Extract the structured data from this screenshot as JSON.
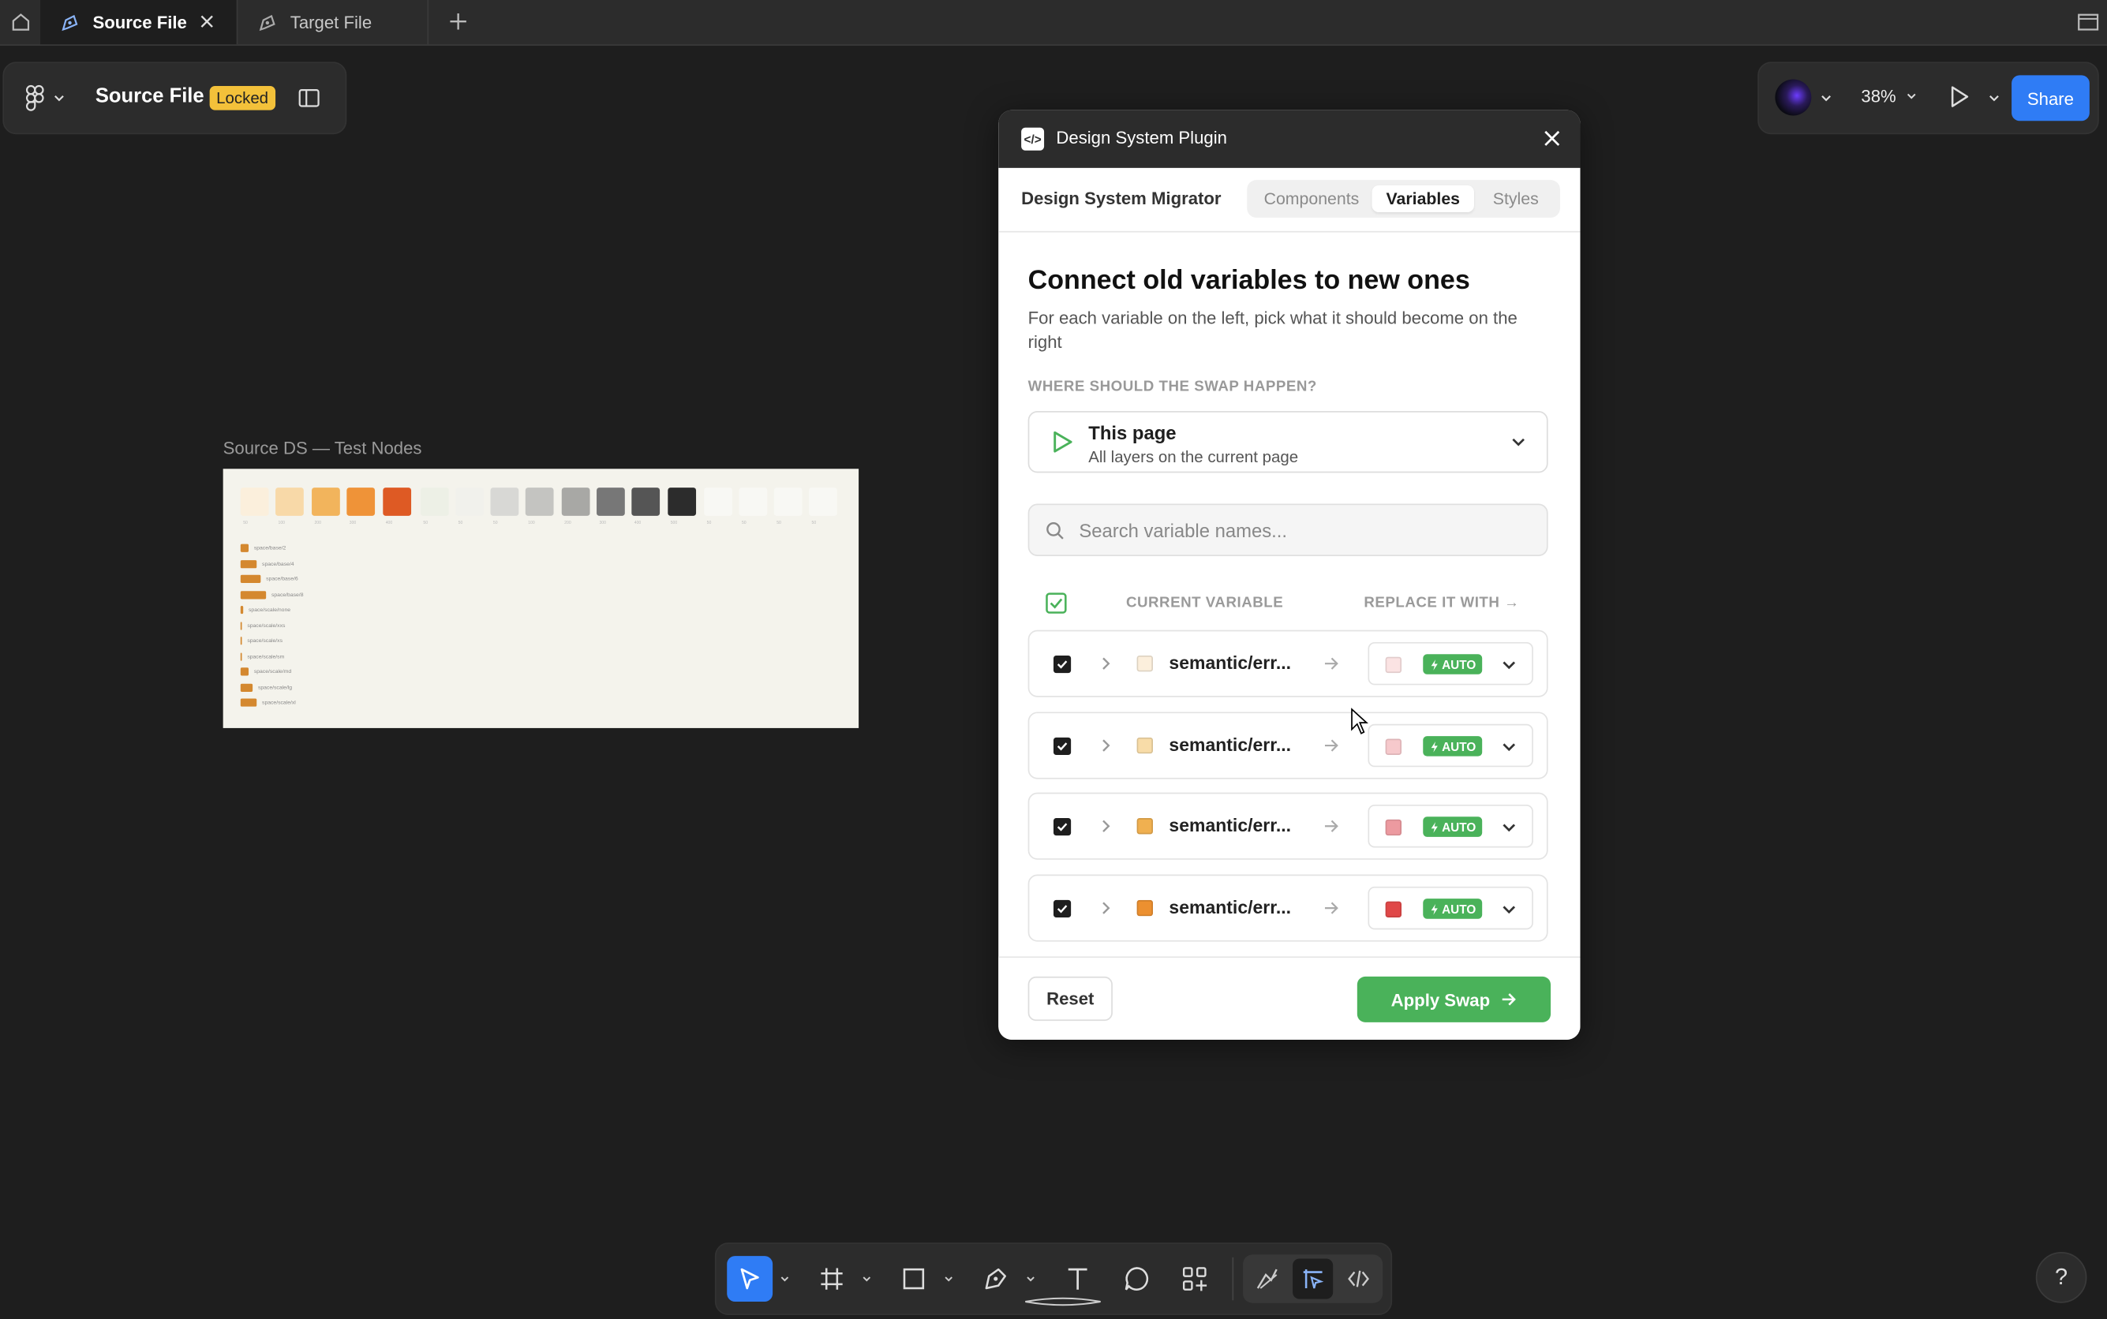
{
  "tabs": {
    "active": "Source File",
    "inactive": "Target File"
  },
  "toolbar": {
    "file_name": "Source File",
    "locked_badge": "Locked",
    "zoom": "38%",
    "share_label": "Share"
  },
  "canvas": {
    "frame_label": "Source DS — Test Nodes",
    "swatch_colors": [
      "#fbefdc",
      "#f8d9a8",
      "#f2b45c",
      "#ef9338",
      "#de5a24",
      "#edf0e6",
      "#f1f1ec",
      "#d8d8d5",
      "#c4c4c1",
      "#a8a8a5",
      "#777777",
      "#555555",
      "#2c2c2c",
      "#f8f8f4",
      "#f8f8f4",
      "#f8f8f4",
      "#f8f8f4"
    ],
    "swatch_labels": [
      "50",
      "100",
      "200",
      "300",
      "400",
      "50",
      "50",
      "50",
      "100",
      "200",
      "300",
      "400",
      "500",
      "50",
      "50",
      "50",
      "50"
    ],
    "spacing_labels": [
      "space/base/2",
      "space/base/4",
      "space/base/6",
      "space/base/8",
      "space/scale/none",
      "space/scale/xxs",
      "space/scale/xs",
      "space/scale/sm",
      "space/scale/md",
      "space/scale/lg",
      "space/scale/xl"
    ]
  },
  "plugin": {
    "title": "Design System Plugin",
    "migrator_label": "Design System Migrator",
    "tabs": [
      "Components",
      "Variables",
      "Styles"
    ],
    "selected_tab": "Variables",
    "heading": "Connect old variables to new ones",
    "subheading": "For each variable on the left, pick what it should become on the right",
    "where_label": "WHERE SHOULD THE SWAP HAPPEN?",
    "scope": {
      "title": "This page",
      "subtitle": "All layers on the current page"
    },
    "search_placeholder": "Search variable names...",
    "col_current": "CURRENT VARIABLE",
    "col_replace": "REPLACE IT WITH →",
    "rows": [
      {
        "name": "semantic/err...",
        "old_color": "#fcefdc",
        "new_color": "#fbe3e3",
        "badge": "AUTO"
      },
      {
        "name": "semantic/err...",
        "old_color": "#f8dca8",
        "new_color": "#f6c9cc",
        "badge": "AUTO"
      },
      {
        "name": "semantic/err...",
        "old_color": "#f0b050",
        "new_color": "#ec9aa0",
        "badge": "AUTO"
      },
      {
        "name": "semantic/err...",
        "old_color": "#ec9030",
        "new_color": "#e04848",
        "badge": "AUTO"
      }
    ],
    "reset_label": "Reset",
    "apply_label": "Apply Swap",
    "accent_color": "#4ab25a"
  },
  "bottom_tools": [
    "move-tool",
    "frame-tool",
    "rectangle-tool",
    "pen-tool",
    "text-tool",
    "comment-tool",
    "actions-tool"
  ],
  "help_label": "?"
}
